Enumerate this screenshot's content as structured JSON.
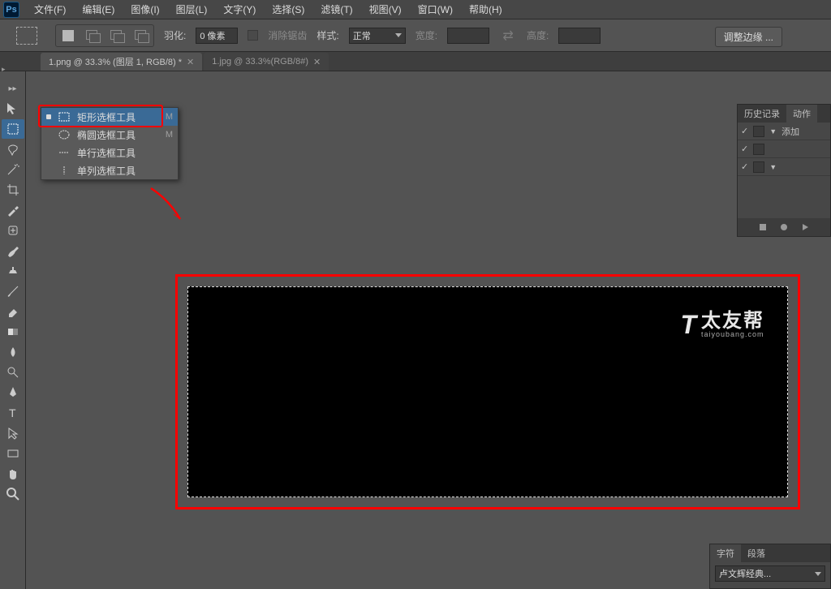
{
  "menubar": {
    "items": [
      "文件(F)",
      "编辑(E)",
      "图像(I)",
      "图层(L)",
      "文字(Y)",
      "选择(S)",
      "滤镜(T)",
      "视图(V)",
      "窗口(W)",
      "帮助(H)"
    ]
  },
  "optionsbar": {
    "feather_label": "羽化:",
    "feather_value": "0 像素",
    "antialias": "消除锯齿",
    "style_label": "样式:",
    "style_value": "正常",
    "width_label": "宽度:",
    "height_label": "高度:",
    "refine_edge": "调整边缘 ..."
  },
  "tabs": [
    {
      "title": "1.png @ 33.3% (图层 1, RGB/8) *"
    },
    {
      "title": "1.jpg @ 33.3%(RGB/8#)"
    }
  ],
  "flyout": {
    "items": [
      {
        "label": "矩形选框工具",
        "key": "M",
        "icon": "rect"
      },
      {
        "label": "椭圆选框工具",
        "key": "M",
        "icon": "ellipse"
      },
      {
        "label": "单行选框工具",
        "key": "",
        "icon": "row"
      },
      {
        "label": "单列选框工具",
        "key": "",
        "icon": "col"
      }
    ]
  },
  "history_panel": {
    "tab1": "历史记录",
    "tab2": "动作",
    "add_label": "添加"
  },
  "char_panel": {
    "tab1": "字符",
    "tab2": "段落",
    "font": "卢文辉经典..."
  },
  "watermark": {
    "cn": "太友帮",
    "en": "taiyoubang.com"
  }
}
